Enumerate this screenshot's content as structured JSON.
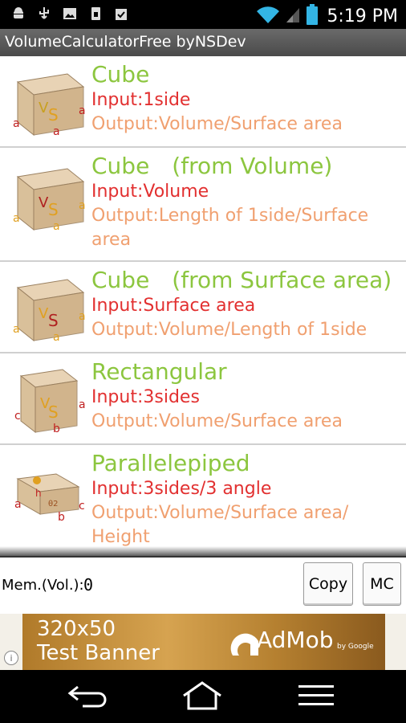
{
  "status_bar": {
    "time": "5:19 PM",
    "left_icons": [
      "android-icon",
      "usb-icon",
      "image-icon",
      "sim-icon",
      "clipboard-check-icon"
    ],
    "right_icons": [
      "wifi-icon",
      "signal-icon",
      "battery-icon"
    ]
  },
  "app": {
    "title": "VolumeCalculatorFree byNSDev"
  },
  "items": [
    {
      "title": "Cube",
      "input": "Input:1side",
      "output": "Output:Volume/Surface area",
      "icon": "cube-icon",
      "thumb_letters": {
        "v": "V",
        "s": "S",
        "side_a": "a",
        "bottom_a": "a",
        "front_a": "a"
      }
    },
    {
      "title": "Cube　(from Volume)",
      "input": "Input:Volume",
      "output": "Output:Length of 1side/Surface area",
      "icon": "cube-from-volume-icon",
      "thumb_letters": {
        "v": "V",
        "s": "S",
        "side_a": "a",
        "bottom_a": "a",
        "front_a": "a"
      }
    },
    {
      "title": "Cube　(from Surface area)",
      "input": "Input:Surface area",
      "output": "Output:Volume/Length of 1side",
      "icon": "cube-from-surface-icon",
      "thumb_letters": {
        "v": "V",
        "s": "S",
        "side_a": "a",
        "bottom_a": "a",
        "front_a": "a"
      }
    },
    {
      "title": "Rectangular",
      "input": "Input:3sides",
      "output": "Output:Volume/Surface area",
      "icon": "rectangular-icon",
      "thumb_letters": {
        "v": "V",
        "s": "S",
        "side_a": "a",
        "bottom_a": "b",
        "front_a": "c"
      }
    },
    {
      "title": "Parallelepiped",
      "input": "Input:3sides/3 angle",
      "output": "Output:Volume/Surface area/\nHeight",
      "icon": "parallelepiped-icon",
      "thumb_letters": {
        "v": "h",
        "s": "θ2",
        "side_a": "c",
        "bottom_a": "b",
        "front_a": "a"
      }
    }
  ],
  "memory": {
    "label": "Mem.(Vol.):",
    "value": "0"
  },
  "buttons": {
    "copy": "Copy",
    "mc": "MC"
  },
  "banner": {
    "line1": "320x50",
    "line2": "Test Banner",
    "brand": "AdMob",
    "by": "by Google",
    "info": "i"
  },
  "colors": {
    "title": "#8cc63f",
    "input": "#e23030",
    "output": "#f0a070"
  }
}
